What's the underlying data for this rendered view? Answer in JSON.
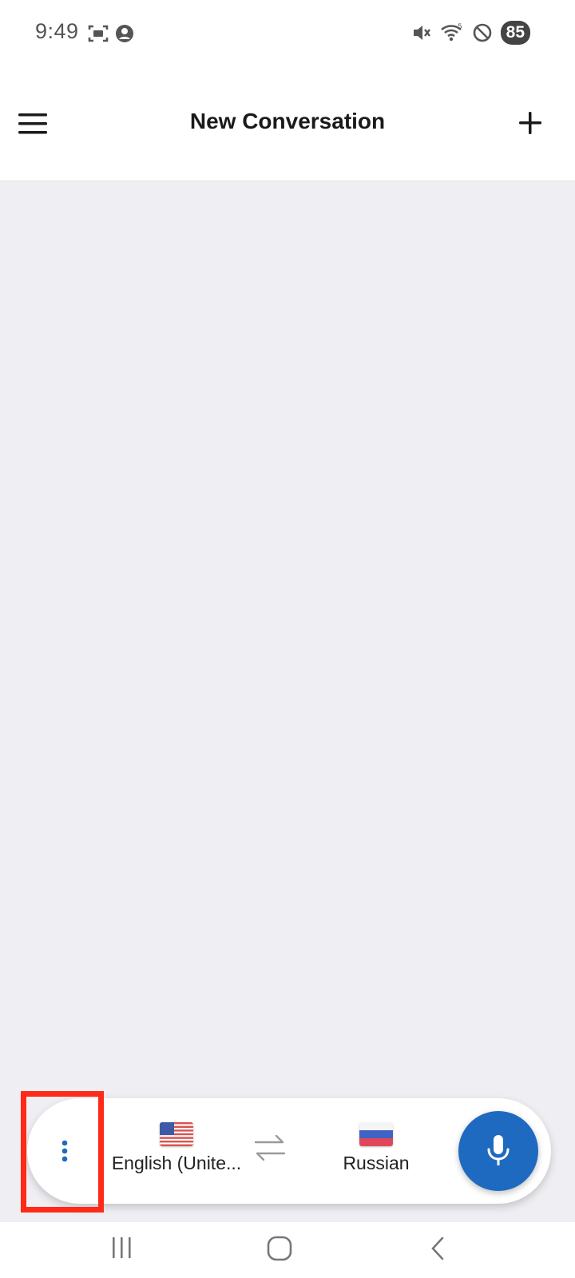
{
  "status_bar": {
    "time": "9:49",
    "left_icons": [
      "screenshot-icon",
      "account-circle-icon"
    ],
    "right_icons": [
      "mute-icon",
      "wifi-icon",
      "do-not-disturb-icon"
    ],
    "battery": "85"
  },
  "app_bar": {
    "title": "New Conversation",
    "menu_icon": "hamburger-menu-icon",
    "add_icon": "plus-icon"
  },
  "bottom_panel": {
    "more_icon": "more-vertical-icon",
    "source_language": {
      "name": "English (Unite...",
      "flag": "us-flag-icon"
    },
    "swap_icon": "swap-arrows-icon",
    "target_language": {
      "name": "Russian",
      "flag": "russia-flag-icon"
    },
    "mic_icon": "microphone-icon"
  },
  "colors": {
    "accent": "#1e6ac1",
    "content_background": "#eeeef3",
    "highlight": "#ff2a17"
  },
  "nav_bar": {
    "buttons": [
      "recent-apps-icon",
      "home-icon",
      "back-icon"
    ]
  }
}
